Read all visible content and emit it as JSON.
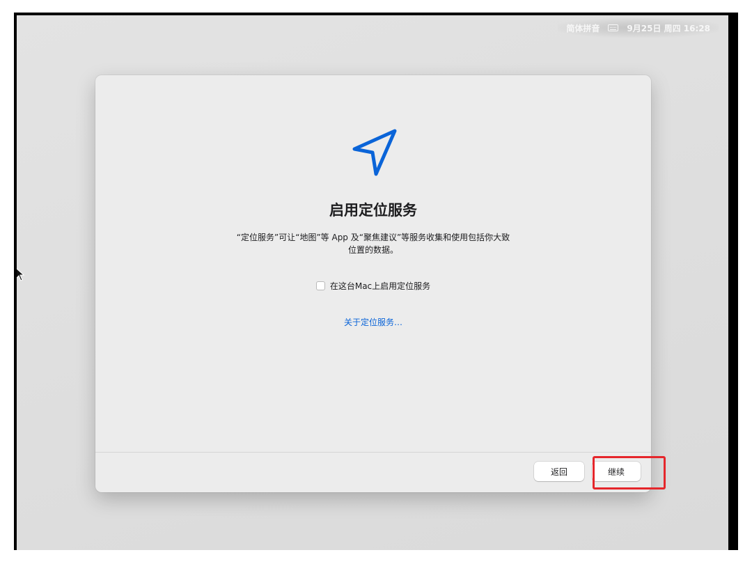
{
  "status_bar": {
    "input_method": "简体拼音",
    "datetime": "9月25日 周四 16:28"
  },
  "dialog": {
    "icon": "location-arrow-icon",
    "title": "启用定位服务",
    "description": "“定位服务”可让“地图”等 App 及“聚焦建议”等服务收集和使用包括你大致位置的数据。",
    "checkbox_label": "在这台Mac上启用定位服务",
    "checkbox_checked": false,
    "link": "关于定位服务…",
    "back_button": "返回",
    "continue_button": "继续"
  },
  "colors": {
    "accent_blue": "#0a64d8",
    "highlight_red": "#e5262b",
    "dialog_bg": "#ececec"
  }
}
